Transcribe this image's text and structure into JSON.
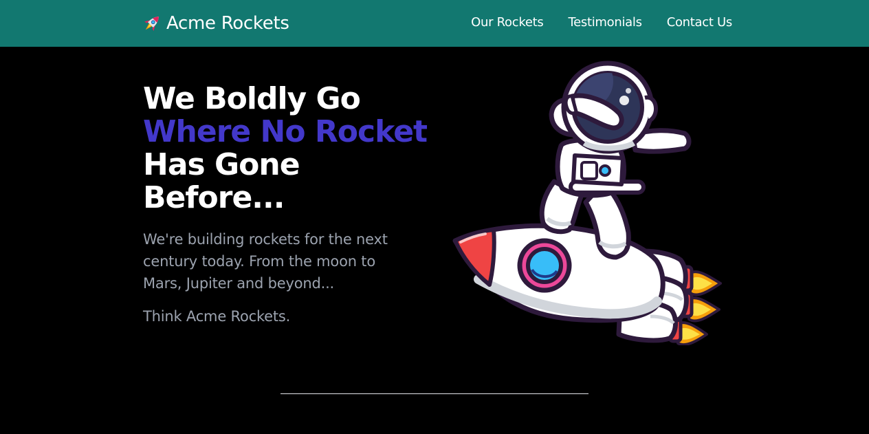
{
  "header": {
    "brand_name": "Acme Rockets",
    "brand_icon": "rocket-icon",
    "background_color": "#127870",
    "nav": [
      {
        "label": "Our Rockets"
      },
      {
        "label": "Testimonials"
      },
      {
        "label": "Contact Us"
      }
    ]
  },
  "hero": {
    "title_lines": [
      "We Boldly Go",
      "Where No Rocket",
      "Has Gone",
      "Before..."
    ],
    "accent_color": "#4338ca",
    "description": "We're building rockets for the next century today. From the moon to Mars, Jupiter and beyond...",
    "tagline": "Think Acme Rockets.",
    "illustration": "astronaut-riding-rocket-illustration"
  }
}
